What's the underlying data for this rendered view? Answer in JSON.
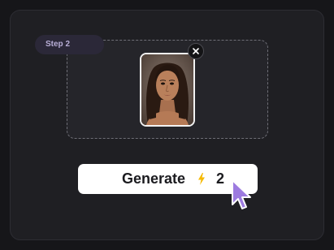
{
  "step": {
    "label": "Step 2"
  },
  "upload": {
    "image_description_icon": "portrait-photo",
    "remove_icon": "close-icon",
    "remove_glyph": "×"
  },
  "generate": {
    "label": "Generate",
    "credit_icon": "lightning-bolt-icon",
    "credit_cost": "2"
  },
  "colors": {
    "accent_purple": "#9d7be0",
    "bolt_yellow": "#f6b900",
    "card_bg": "#1f1f23",
    "page_bg": "#161619"
  }
}
